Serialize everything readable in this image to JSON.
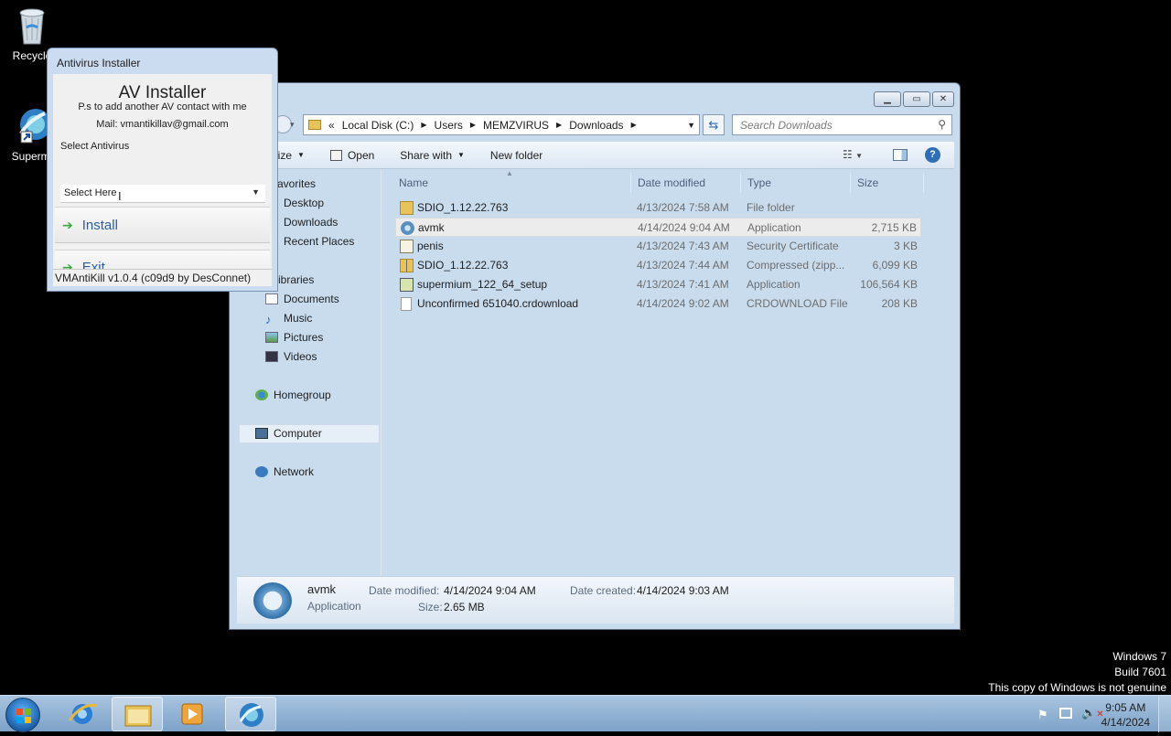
{
  "desktop": {
    "icons": [
      {
        "label": "Recycle",
        "icon": "recycle-bin-icon"
      },
      {
        "label": "Supermi",
        "icon": "supermium-icon"
      }
    ],
    "watermark": [
      "Windows 7",
      "Build 7601",
      "This copy of Windows is not genuine"
    ]
  },
  "explorer": {
    "address": {
      "back_sep": "«",
      "crumbs": [
        "Local Disk (C:)",
        "Users",
        "MEMZVIRUS",
        "Downloads"
      ]
    },
    "search_placeholder": "Search Downloads",
    "toolbar": {
      "organize": "nize",
      "open": "Open",
      "share": "Share with",
      "new_folder": "New folder"
    },
    "nav": {
      "favorites": "avorites",
      "desktop": "Desktop",
      "downloads": "Downloads",
      "recent": "Recent Places",
      "libraries": "ibraries",
      "documents": "Documents",
      "music": "Music",
      "pictures": "Pictures",
      "videos": "Videos",
      "homegroup": "Homegroup",
      "computer": "Computer",
      "network": "Network"
    },
    "columns": [
      "Name",
      "Date modified",
      "Type",
      "Size"
    ],
    "files": [
      {
        "name": "SDIO_1.12.22.763",
        "date": "4/13/2024 7:58 AM",
        "type": "File folder",
        "size": "",
        "icon": "folder-icon"
      },
      {
        "name": "avmk",
        "date": "4/14/2024 9:04 AM",
        "type": "Application",
        "size": "2,715 KB",
        "icon": "application-icon"
      },
      {
        "name": "penis",
        "date": "4/13/2024 7:43 AM",
        "type": "Security Certificate",
        "size": "3 KB",
        "icon": "certificate-icon"
      },
      {
        "name": "SDIO_1.12.22.763",
        "date": "4/13/2024 7:44 AM",
        "type": "Compressed (zipp...",
        "size": "6,099 KB",
        "icon": "zip-folder-icon"
      },
      {
        "name": "supermium_122_64_setup",
        "date": "4/13/2024 7:41 AM",
        "type": "Application",
        "size": "106,564 KB",
        "icon": "installer-icon"
      },
      {
        "name": "Unconfirmed 651040.crdownload",
        "date": "4/14/2024 9:02 AM",
        "type": "CRDOWNLOAD File",
        "size": "208 KB",
        "icon": "file-icon"
      }
    ],
    "details": {
      "name": "avmk",
      "kind": "Application",
      "date_modified_label": "Date modified:",
      "date_modified": "4/14/2024 9:04 AM",
      "size_label": "Size:",
      "size": "2.65 MB",
      "date_created_label": "Date created:",
      "date_created": "4/14/2024 9:03 AM"
    }
  },
  "av_installer": {
    "title": "Antivirus Installer",
    "heading": "AV Installer",
    "note": "P.s to add another AV contact with me",
    "mail": "Mail: vmantikillav@gmail.com",
    "select_label": "Select Antivirus",
    "select_value": "Select Here",
    "install_label": "Install",
    "exit_label": "Exit",
    "status": "VMAntiKill v1.0.4 (c09d9 by DesConnet)"
  },
  "taskbar": {
    "time": "9:05 AM",
    "date": "4/14/2024"
  },
  "colors": {
    "accent": "#2a5fa5",
    "taskbar": "#a9c4e0"
  }
}
